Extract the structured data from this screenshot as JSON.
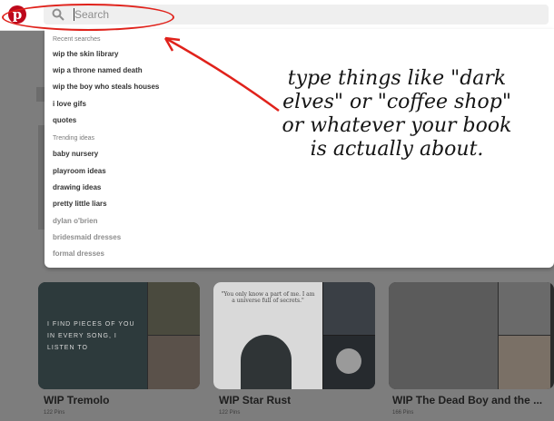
{
  "header": {
    "search_placeholder": "Search"
  },
  "dropdown": {
    "recent_heading": "Recent searches",
    "recent": [
      "wip the skin library",
      "wip a throne named death",
      "wip the boy who steals houses",
      "i love gifs",
      "quotes"
    ],
    "trending_heading": "Trending ideas",
    "trending": [
      "baby nursery",
      "playroom ideas",
      "drawing ideas",
      "pretty little liars",
      "dylan o'brien",
      "bridesmaid dresses",
      "formal dresses"
    ]
  },
  "boards": [
    {
      "title": "WIP Tremolo",
      "count": "122 Pins",
      "cover_text": "I FIND PIECES OF YOU IN EVERY SONG, I LISTEN TO"
    },
    {
      "title": "WIP Star Rust",
      "count": "122 Pins",
      "cover_text": "\"You only know a part of me. I am a universe full of secrets.\""
    },
    {
      "title": "WIP The Dead Boy and the ...",
      "count": "166 Pins",
      "cover_text": ""
    }
  ],
  "annotation": {
    "lines": [
      "type things like \"dark",
      "elves\" or \"coffee shop\"",
      "or whatever your book",
      "is actually about."
    ],
    "color": "#e0221b"
  },
  "colors": {
    "brand": "#bd081c",
    "overlay": "#7d7d7d"
  }
}
